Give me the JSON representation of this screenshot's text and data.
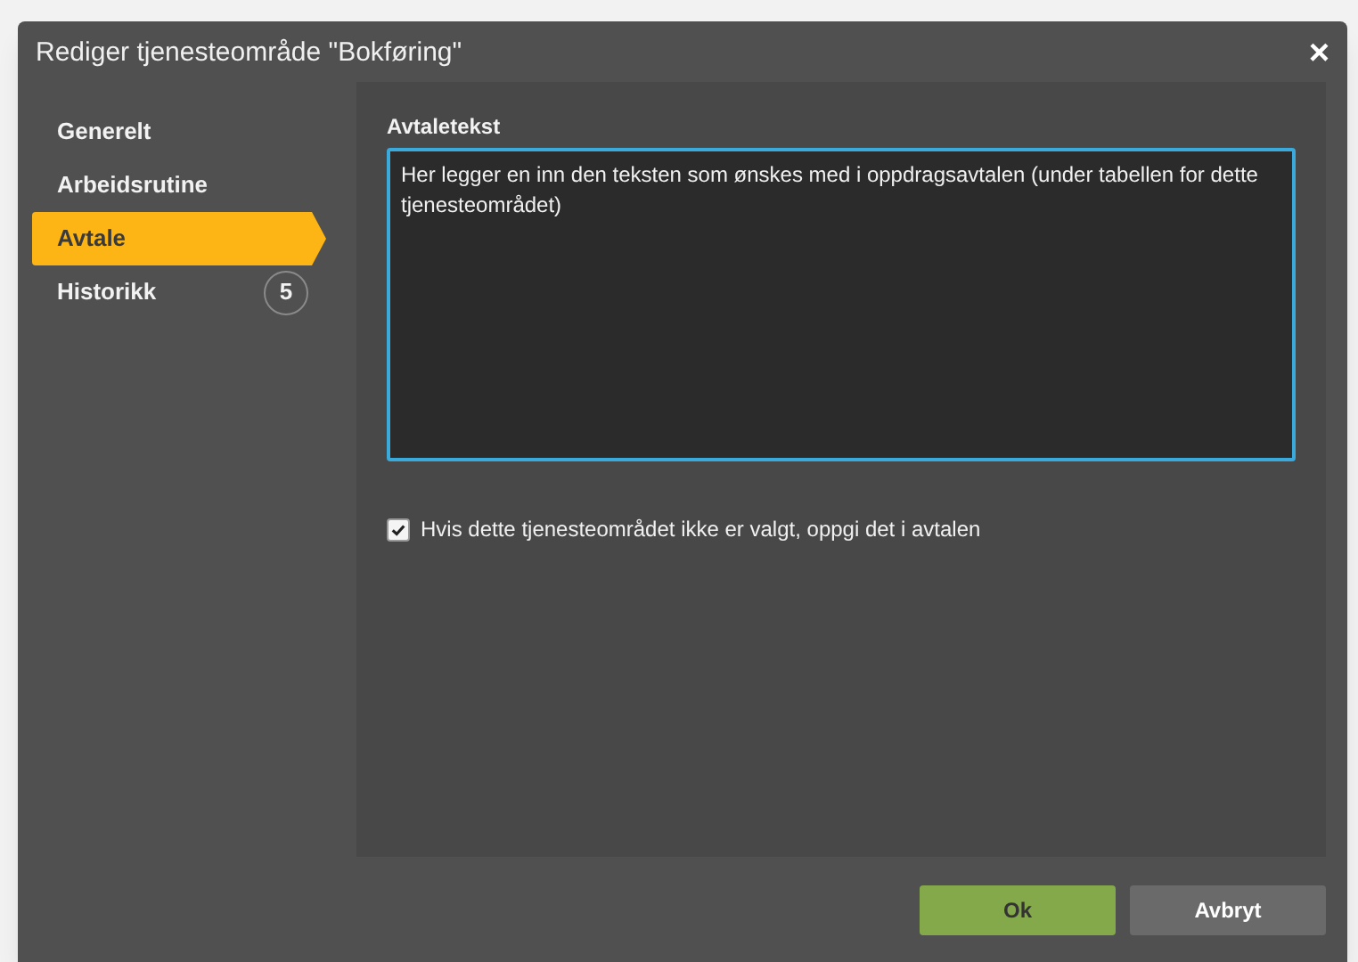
{
  "dialog": {
    "title": "Rediger tjenesteområde \"Bokføring\"",
    "close": "×"
  },
  "nav": [
    {
      "label": "Generelt",
      "selected": false
    },
    {
      "label": "Arbeidsrutine",
      "selected": false
    },
    {
      "label": "Avtale",
      "selected": true
    },
    {
      "label": "Historikk",
      "selected": false,
      "count": "5"
    }
  ],
  "field": {
    "label": "Avtaletekst",
    "value": "Her legger en inn den teksten som ønskes med i oppdragsavtalen (under tabellen for dette tjenesteområdet)"
  },
  "checkbox": {
    "label": "Hvis dette tjenesteområdet ikke er valgt, oppgi det i avtalen",
    "checked": true
  },
  "buttons": [
    {
      "label": "Ok",
      "kind": "primary"
    },
    {
      "label": "Avbryt",
      "kind": "secondary"
    }
  ]
}
